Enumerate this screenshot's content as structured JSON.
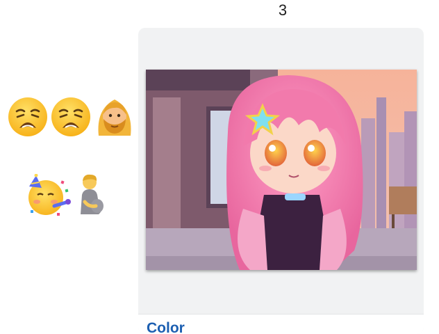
{
  "counter": "3",
  "emoji_groups": [
    {
      "icons": [
        "weary-face-icon",
        "weary-face-icon",
        "woman-with-beard-icon"
      ]
    },
    {
      "icons": [
        "partying-face-icon",
        "pregnant-man-icon"
      ]
    }
  ],
  "card": {
    "title": "Color",
    "image": "chibi-character-pink-hair-image"
  },
  "colors": {
    "card_bg": "#f1f2f3",
    "title_link": "#1c5fb1",
    "hair_pink": "#f48ab5"
  }
}
